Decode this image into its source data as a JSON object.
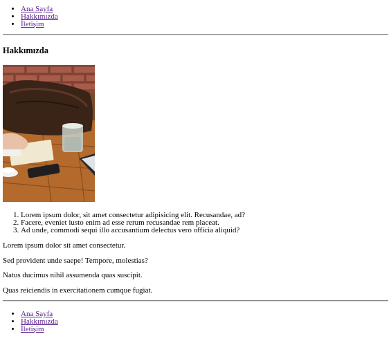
{
  "nav_top": {
    "items": [
      {
        "label": "Ana Sayfa"
      },
      {
        "label": "Hakkımızda"
      },
      {
        "label": "İletişim"
      }
    ]
  },
  "page": {
    "title": "Hakkımızda",
    "image": {
      "icon": "photo-desk-laptop-bag"
    },
    "list": [
      "Lorem ipsum dolor, sit amet consectetur adipisicing elit. Recusandae, ad?",
      "Facere, eveniet iusto enim ad esse rerum recusandae rem placeat.",
      "Ad unde, commodi sequi illo accusantium delectus vero officia aliquid?"
    ],
    "paragraphs": [
      "Lorem ipsum dolor sit amet consectetur.",
      "Sed provident unde saepe! Tempore, molestias?",
      "Natus ducimus nihil assumenda quas suscipit.",
      "Quas reiciendis in exercitationem cumque fugiat."
    ]
  },
  "nav_bottom": {
    "items": [
      {
        "label": "Ana Sayfa"
      },
      {
        "label": "Hakkımızda"
      },
      {
        "label": "İletişim"
      }
    ]
  },
  "colors": {
    "link_visited": "#551a8b",
    "rule": "#8a8a8a",
    "text": "#000000",
    "background": "#ffffff"
  }
}
